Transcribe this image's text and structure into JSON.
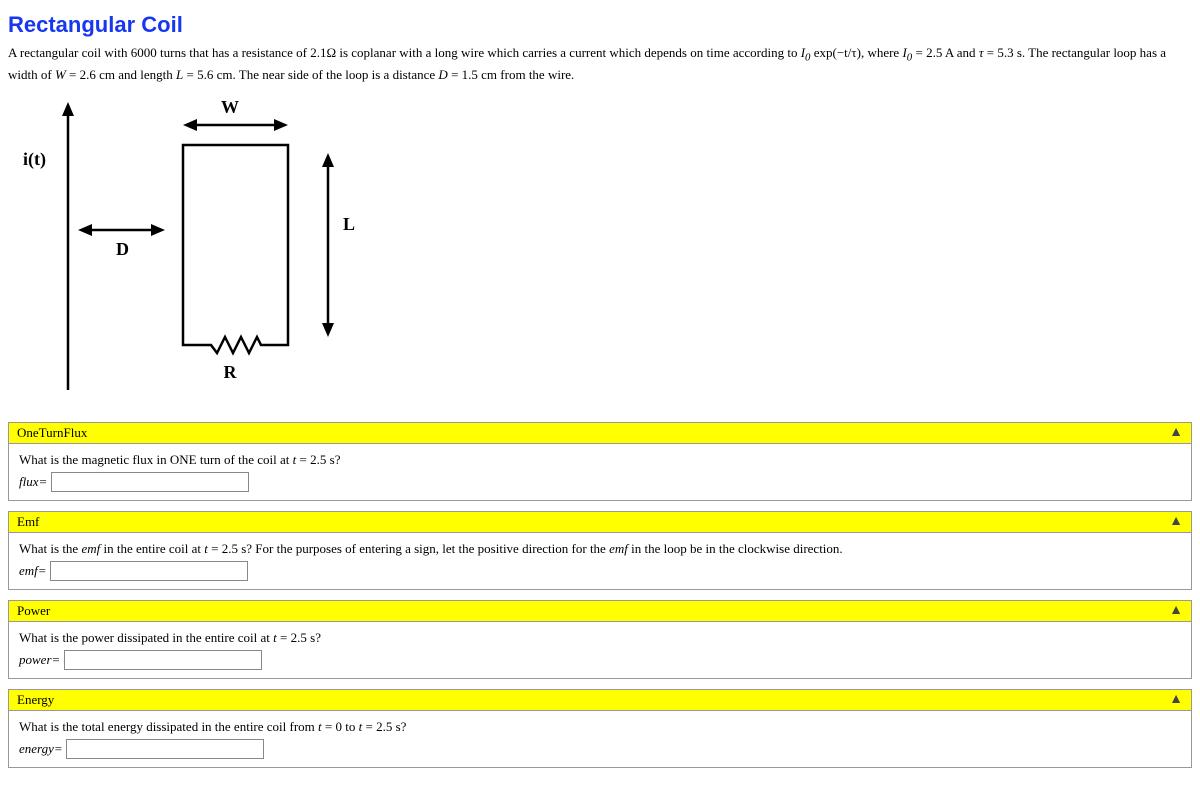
{
  "title": "Rectangular Coil",
  "problem": {
    "pre1": "A rectangular coil with ",
    "turns": "6000",
    "mid1": " turns that has a resistance of ",
    "resistance": "2.1Ω",
    "mid2": " is coplanar with a long wire which carries a current which depends on time according to ",
    "expr_lhs": "I",
    "expr_sub": "0",
    "expr_body": " exp(−t/τ)",
    "mid3": ", where ",
    "I0_sym": "I",
    "I0_sub": "0",
    "eq1": " = ",
    "I0_val": "2.5 A",
    "mid4": " and ",
    "tau_sym": "τ",
    "eq2": " = ",
    "tau_val": "5.3 s",
    "mid5": ". The rectangular loop has a width of ",
    "W_sym": "W",
    "eq3": " = ",
    "W_val": "2.6 cm",
    "mid6": " and length ",
    "L_sym": "L",
    "eq4": " = ",
    "L_val": "5.6 cm",
    "mid7": ". The near side of the loop is a distance ",
    "D_sym": "D",
    "eq5": " = ",
    "D_val": "1.5 cm",
    "mid8": " from the wire."
  },
  "diagram": {
    "i_label": "i(t)",
    "W_label": "W",
    "L_label": "L",
    "D_label": "D",
    "R_label": "R"
  },
  "sections": {
    "flux": {
      "header": "OneTurnFlux",
      "q_pre": "What is the magnetic flux in ONE turn of the coil at ",
      "q_t": "t",
      "q_eq": " = ",
      "q_tval": "2.5 s",
      "q_post": "?",
      "label": "flux=",
      "value": ""
    },
    "emf": {
      "header": "Emf",
      "q_pre": "What is the ",
      "q_em": "emf",
      "q_mid1": " in the entire coil at ",
      "q_t": "t",
      "q_eq": " = ",
      "q_tval": "2.5 s",
      "q_mid2": "? For the purposes of entering a sign, let the positive direction for the ",
      "q_em2": "emf",
      "q_post": " in the loop be in the clockwise direction.",
      "label": "emf=",
      "value": ""
    },
    "power": {
      "header": "Power",
      "q_pre": "What is the power dissipated in the entire coil at ",
      "q_t": "t",
      "q_eq": " = ",
      "q_tval": "2.5 s",
      "q_post": "?",
      "label": "power=",
      "value": ""
    },
    "energy": {
      "header": "Energy",
      "q_pre": "What is the total energy dissipated in the entire coil from ",
      "q_t1": "t",
      "q_eq1": " = ",
      "q_t1val": "0",
      "q_to": " to ",
      "q_t2": "t",
      "q_eq2": " = ",
      "q_t2val": "2.5 s",
      "q_post": "?",
      "label": "energy=",
      "value": ""
    }
  }
}
